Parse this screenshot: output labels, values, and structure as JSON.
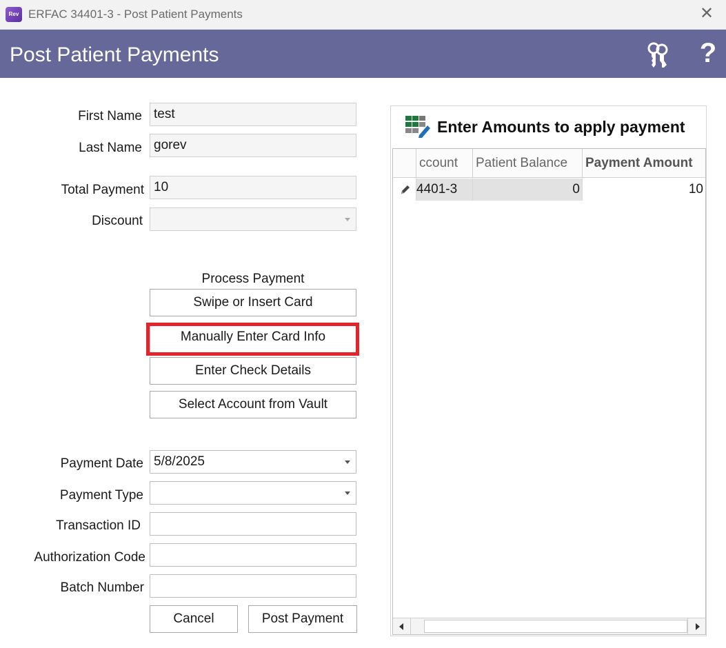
{
  "window": {
    "title": "ERFAC 34401-3 - Post Patient Payments",
    "app_icon_text": "Rev",
    "close_glyph": "✕"
  },
  "header": {
    "title": "Post Patient Payments",
    "help_glyph": "?",
    "background_color": "#666899"
  },
  "form": {
    "first_name": {
      "label": "First Name",
      "value": "test"
    },
    "last_name": {
      "label": "Last Name",
      "value": "gorev"
    },
    "total_payment": {
      "label": "Total Payment",
      "value": "10"
    },
    "discount": {
      "label": "Discount",
      "value": ""
    },
    "payment_date": {
      "label": "Payment Date",
      "value": "5/8/2025"
    },
    "payment_type": {
      "label": "Payment Type",
      "value": ""
    },
    "transaction_id": {
      "label": "Transaction ID",
      "value": ""
    },
    "authorization_code": {
      "label": "Authorization Code",
      "value": ""
    },
    "batch_number": {
      "label": "Batch Number",
      "value": ""
    }
  },
  "process_payment": {
    "label": "Process Payment",
    "swipe_label": "Swipe or Insert Card",
    "manual_label": "Manually Enter Card Info",
    "check_label": "Enter Check Details",
    "vault_label": "Select Account from Vault",
    "highlight_color": "#e3242b"
  },
  "actions": {
    "cancel_label": "Cancel",
    "post_label": "Post Payment"
  },
  "grid": {
    "title": "Enter Amounts to apply payment",
    "columns": [
      "ccount",
      "Patient Balance",
      "Payment Amount"
    ],
    "rows": [
      {
        "account": "4401-3",
        "patient_balance": "0",
        "payment_amount": "10"
      }
    ]
  }
}
